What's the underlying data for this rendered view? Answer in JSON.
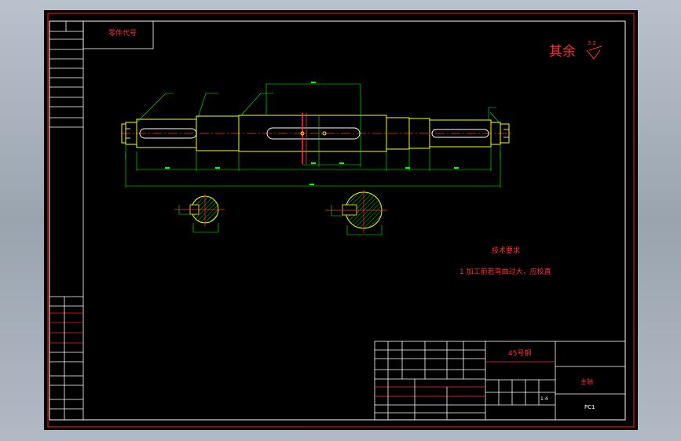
{
  "title_block_top_left": {
    "part_code": "零件代号"
  },
  "roughness": {
    "label": "其余",
    "value": "3.2"
  },
  "technical_requirements": {
    "heading": "技术要求",
    "item_1": "1  加工前若弯曲过大，应校直"
  },
  "title_block": {
    "material": "45号钢",
    "part_name": "主轴",
    "scale": "1:4",
    "drawing_no": "PC1"
  },
  "colors": {
    "sheet_bg": "#000000",
    "frame": "#ff2020",
    "white_lines": "#ffffff",
    "shaft_outline": "#ffff00",
    "dimensions": "#00ff00",
    "hatch": "#00ff00",
    "keyway_section": "#ffff00",
    "center_line": "#ff3030"
  },
  "icons": {
    "roughness_symbol": "roughness-triangle-icon"
  }
}
